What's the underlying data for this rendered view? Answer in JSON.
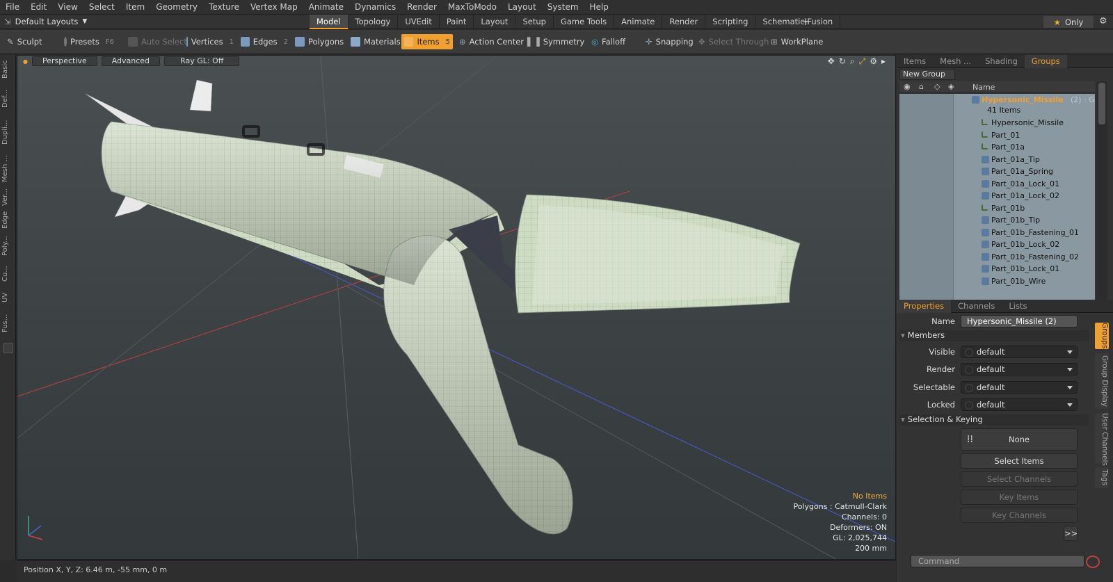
{
  "menu": [
    "File",
    "Edit",
    "View",
    "Select",
    "Item",
    "Geometry",
    "Texture",
    "Vertex Map",
    "Animate",
    "Dynamics",
    "Render",
    "MaxToModo",
    "Layout",
    "System",
    "Help"
  ],
  "layouts": {
    "label": "Default Layouts"
  },
  "layout_tabs": [
    "Model",
    "Topology",
    "UVEdit",
    "Paint",
    "Layout",
    "Setup",
    "Game Tools",
    "Animate",
    "Render",
    "Scripting",
    "Schematic Fusion"
  ],
  "layout_tabs_active": "Model",
  "only_label": "Only",
  "toolbar": {
    "sculpt": "Sculpt",
    "presets": "Presets",
    "presets_key": "F6",
    "auto_select": "Auto Select",
    "vertices": "Vertices",
    "vertices_key": "1",
    "edges": "Edges",
    "edges_key": "2",
    "polygons": "Polygons",
    "materials": "Materials",
    "items": "Items",
    "items_key": "5",
    "action_center": "Action Center",
    "symmetry": "Symmetry",
    "falloff": "Falloff",
    "snapping": "Snapping",
    "select_through": "Select Through",
    "workplane": "WorkPlane"
  },
  "left_tabs": [
    "Basic",
    "Def...",
    "Dupli...",
    "Mesh ...",
    "Ver...",
    "Edge",
    "Poly...",
    "Cu...",
    "UV",
    "Fus..."
  ],
  "viewport": {
    "perspective": "Perspective",
    "advanced": "Advanced",
    "raygl": "Ray GL: Off",
    "hud": {
      "no_items": "No Items",
      "polygons": "Polygons : Catmull-Clark",
      "channels": "Channels: 0",
      "deformers": "Deformers: ON",
      "gl": "GL: 2,025,744",
      "scale": "200 mm"
    }
  },
  "status": {
    "position": "Position X, Y, Z:  6.46 m, -55 mm, 0 m"
  },
  "groups_panel": {
    "tabs": [
      "Items",
      "Mesh ...",
      "Shading",
      "Groups"
    ],
    "active_tab": "Groups",
    "new_group": "New Group",
    "col_name": "Name",
    "group_name": "Hypersonic_Missile",
    "group_suffix": "(2) : G...",
    "group_count": "41 Items",
    "items": [
      "Hypersonic_Missile",
      "Part_01",
      "Part_01a",
      "Part_01a_Tip",
      "Part_01a_Spring",
      "Part_01a_Lock_01",
      "Part_01a_Lock_02",
      "Part_01b",
      "Part_01b_Tip",
      "Part_01b_Fastening_01",
      "Part_01b_Lock_02",
      "Part_01b_Fastening_02",
      "Part_01b_Lock_01",
      "Part_01b_Wire"
    ]
  },
  "properties": {
    "tabs": [
      "Properties",
      "Channels",
      "Lists"
    ],
    "active_tab": "Properties",
    "name_label": "Name",
    "name_value": "Hypersonic_Missile (2)",
    "members_section": "Members",
    "visible_label": "Visible",
    "visible_value": "default",
    "render_label": "Render",
    "render_value": "default",
    "selectable_label": "Selectable",
    "selectable_value": "default",
    "locked_label": "Locked",
    "locked_value": "default",
    "sel_key_section": "Selection & Keying",
    "none_label": "None",
    "select_items": "Select Items",
    "select_channels": "Select Channels",
    "key_items": "Key Items",
    "key_channels": "Key Channels",
    "more": ">>",
    "side_tabs": [
      "Groups",
      "Group Display",
      "User Channels",
      "Tags"
    ],
    "command_placeholder": "Command"
  },
  "colors": {
    "accent": "#f0a030",
    "mesh": "#cfdcc4"
  }
}
